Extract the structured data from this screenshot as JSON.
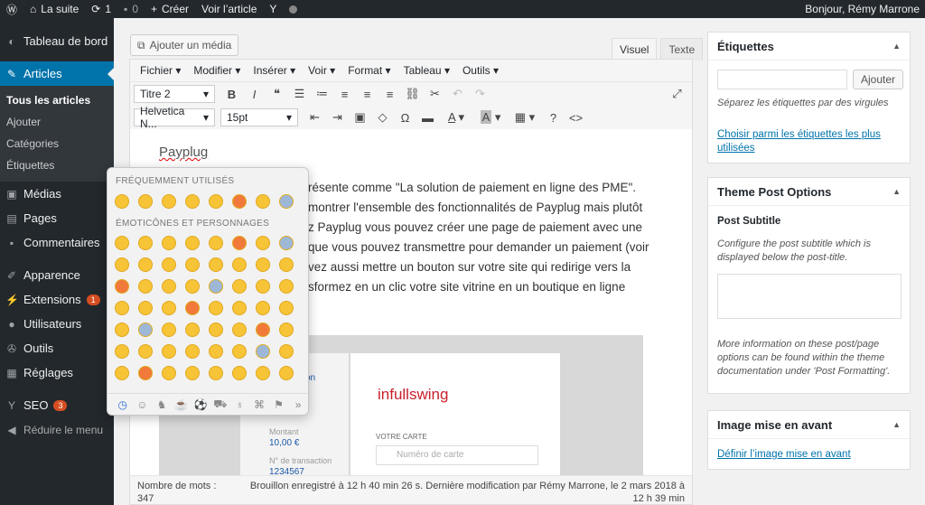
{
  "adminbar": {
    "site": "La suite",
    "updates": "1",
    "comments": "0",
    "new": "Créer",
    "view": "Voir l’article",
    "greeting": "Bonjour, Rémy Marrone"
  },
  "sidebar": {
    "dashboard": "Tableau de bord",
    "articles": "Articles",
    "sub": [
      "Tous les articles",
      "Ajouter",
      "Catégories",
      "Étiquettes"
    ],
    "items": [
      {
        "label": "Médias",
        "icon": "media-icon"
      },
      {
        "label": "Pages",
        "icon": "pages-icon"
      },
      {
        "label": "Commentaires",
        "icon": "comments-icon"
      },
      {
        "label": "Apparence",
        "icon": "appearance-icon"
      },
      {
        "label": "Extensions",
        "icon": "plugins-icon",
        "badge": "1"
      },
      {
        "label": "Utilisateurs",
        "icon": "users-icon"
      },
      {
        "label": "Outils",
        "icon": "tools-icon"
      },
      {
        "label": "Réglages",
        "icon": "settings-icon"
      },
      {
        "label": "SEO",
        "icon": "seo-icon",
        "badge": "3"
      }
    ],
    "collapse": "Réduire le menu"
  },
  "editor": {
    "add_media": "Ajouter un média",
    "tab_visual": "Visuel",
    "tab_text": "Texte",
    "menus": [
      "Fichier",
      "Modifier",
      "Insérer",
      "Voir",
      "Format",
      "Tableau",
      "Outils"
    ],
    "block_format": "Titre 2",
    "font_family": "Helvetica N...",
    "font_size": "15pt",
    "title": "Payplug",
    "lines": [
      "résente comme \"La solution de paiement en ligne des PME\".",
      "montrer l'ensemble des fonctionnalités de Payplug mais plutôt",
      "z Payplug vous pouvez créer une page de paiement avec une",
      "que vous pouvez transmettre pour demander un paiement (voir",
      "vez aussi mettre un bouton sur votre site qui redirige vers la",
      "sformez en un clic votre site vitrine en un boutique en ligne"
    ],
    "image": {
      "logo": "infullswing",
      "card_label": "VOTRE CARTE",
      "card_placeholder": "Numéro de carte",
      "amount_label": "Montant",
      "amount": "10,00 €",
      "txn_label": "N° de transaction",
      "txn": "1234567",
      "on": "on"
    },
    "word_count_label": "Nombre de mots :",
    "word_count": "347",
    "status": "Brouillon enregistré à 12 h 40 min 26 s. Dernière modification par Rémy Marrone, le 2 mars 2018 à 12 h 39 min"
  },
  "emoji_picker": {
    "frequent": "FRÉQUEMMENT UTILISÉS",
    "smileys": "ÉMOTICÔNES ET PERSONNAGES"
  },
  "tags_box": {
    "title": "Étiquettes",
    "add": "Ajouter",
    "hint": "Séparez les étiquettes par des virgules",
    "choose": "Choisir parmi les étiquettes les plus utilisées"
  },
  "theme_box": {
    "title": "Theme Post Options",
    "subtitle_label": "Post Subtitle",
    "desc": "Configure the post subtitle which is displayed below the post-title.",
    "more": "More information on these post/page options can be found within the theme documentation under 'Post Formatting'."
  },
  "featured_box": {
    "title": "Image mise en avant",
    "link": "Définir l’image mise en avant"
  }
}
